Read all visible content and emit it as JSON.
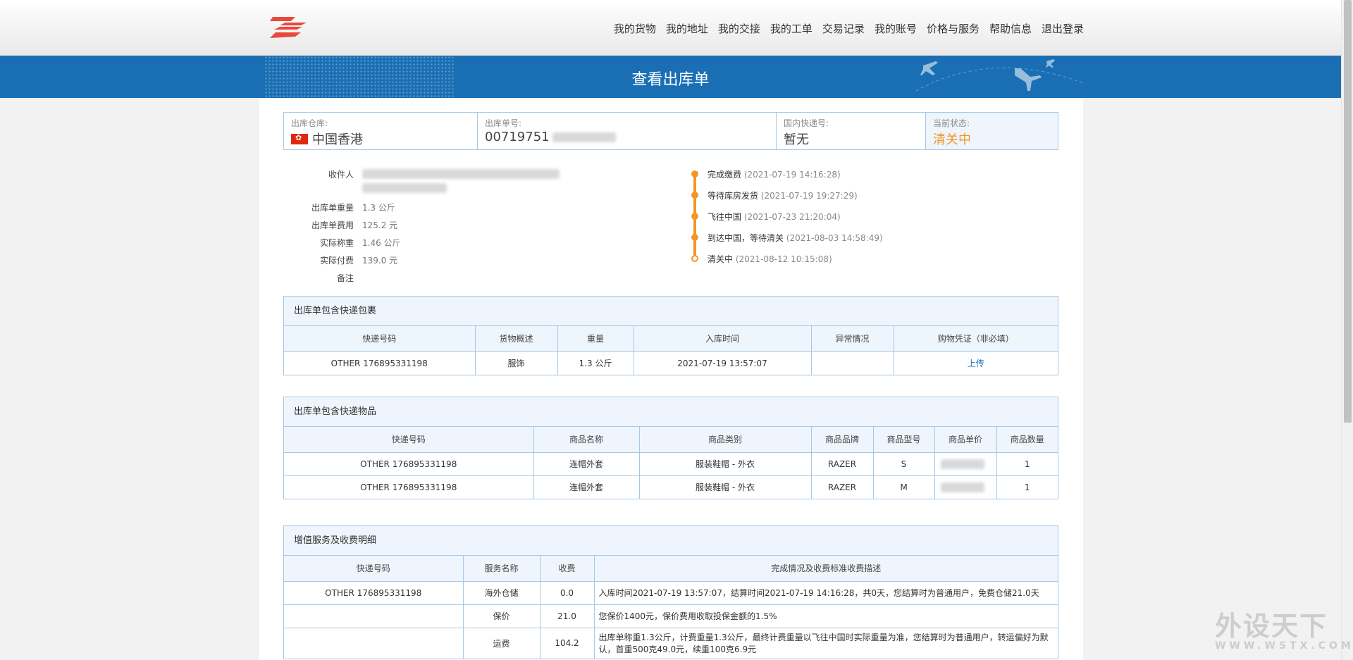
{
  "nav": {
    "items": [
      "我的货物",
      "我的地址",
      "我的交接",
      "我的工单",
      "交易记录",
      "我的账号",
      "价格与服务",
      "帮助信息",
      "退出登录"
    ]
  },
  "banner": {
    "title": "查看出库单"
  },
  "status": {
    "warehouse_label": "出库仓库:",
    "warehouse_value": "中国香港",
    "order_label": "出库单号:",
    "order_value": "00719751",
    "express_label": "国内快递号:",
    "express_value": "暂无",
    "state_label": "当前状态:",
    "state_value": "清关中",
    "state_color": "#f29727"
  },
  "info": {
    "recipient_label": "收件人",
    "weight_label": "出库单重量",
    "weight_value": "1.3 公斤",
    "fee_label": "出库单费用",
    "fee_value": "125.2 元",
    "actual_weight_label": "实际称重",
    "actual_weight_value": "1.46 公斤",
    "actual_paid_label": "实际付费",
    "actual_paid_value": "139.0 元",
    "note_label": "备注"
  },
  "timeline": [
    {
      "event": "完成缴费",
      "time": "(2021-07-19 14:16:28)"
    },
    {
      "event": "等待库房发货",
      "time": "(2021-07-19 19:27:29)"
    },
    {
      "event": "飞往中国",
      "time": "(2021-07-23 21:20:04)"
    },
    {
      "event": "到达中国，等待清关",
      "time": "(2021-08-03 14:58:49)"
    },
    {
      "event": "清关中",
      "time": "(2021-08-12 10:15:08)"
    }
  ],
  "packages": {
    "title": "出库单包含快递包裹",
    "headers": [
      "快递号码",
      "货物概述",
      "重量",
      "入库时间",
      "异常情况",
      "购物凭证（非必填）"
    ],
    "rows": [
      [
        "OTHER 176895331198",
        "服饰",
        "1.3 公斤",
        "2021-07-19 13:57:07",
        "",
        "上传"
      ]
    ]
  },
  "items": {
    "title": "出库单包含快递物品",
    "headers": [
      "快递号码",
      "商品名称",
      "商品类别",
      "商品品牌",
      "商品型号",
      "商品单价",
      "商品数量"
    ],
    "rows": [
      [
        "OTHER 176895331198",
        "连帽外套",
        "服装鞋帽 - 外衣",
        "RAZER",
        "S",
        "",
        "1"
      ],
      [
        "OTHER 176895331198",
        "连帽外套",
        "服装鞋帽 - 外衣",
        "RAZER",
        "M",
        "",
        "1"
      ]
    ]
  },
  "services": {
    "title": "增值服务及收费明细",
    "headers": [
      "快递号码",
      "服务名称",
      "收费",
      "完成情况及收费标准收费描述"
    ],
    "rows": [
      [
        "OTHER 176895331198",
        "海外仓储",
        "0.0",
        "入库时间2021-07-19 13:57:07，结算时间2021-07-19 14:16:28，共0天，您结算时为普通用户，免费仓储21.0天"
      ],
      [
        "",
        "保价",
        "21.0",
        "您保价1400元，保价费用收取投保金额的1.5%"
      ],
      [
        "",
        "运费",
        "104.2",
        "出库单称重1.3公斤，计费重量1.3公斤，最终计费重量以飞往中国时实际重量为准，您结算时为普通用户，转运偏好为默认，首重500克49.0元，续重100克6.9元"
      ]
    ]
  },
  "watermark": {
    "main": "外设天下",
    "sub": "WWW.WSTX.COM"
  }
}
